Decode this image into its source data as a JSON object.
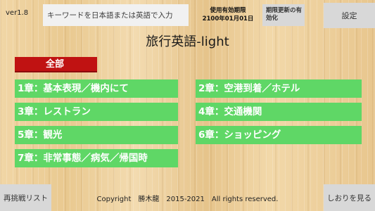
{
  "header": {
    "version": "ver1.8",
    "search_placeholder": "キーワードを日本語または英語で入力",
    "expiry_label": "使用有効期限",
    "expiry_date": "2100年01月01日",
    "renew_label": "期限更新の有効化",
    "settings_label": "設定"
  },
  "app_title": "旅行英語-light",
  "all_label": "全部",
  "chapters": [
    {
      "label": "1章：基本表現／機内にて"
    },
    {
      "label": "2章：空港到着／ホテル"
    },
    {
      "label": "3章：レストラン"
    },
    {
      "label": "4章：交通機関"
    },
    {
      "label": "5章：観光"
    },
    {
      "label": "6章：ショッピング"
    },
    {
      "label": "7章：非常事態／病気／帰国時"
    }
  ],
  "footer": {
    "retry_list_label": "再挑戦リスト",
    "copyright": "Copyright　勝木龍　2015-2021　All rights reserved.",
    "bookmarks_label": "しおりを見る"
  },
  "colors": {
    "chapter_button": "#5fd766",
    "all_button": "#c01212",
    "gray_button": "#d8d8d8"
  }
}
